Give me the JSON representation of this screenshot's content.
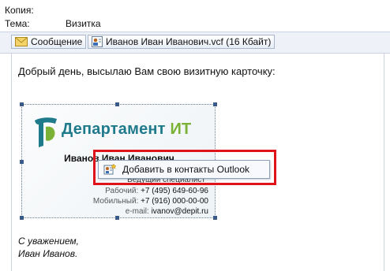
{
  "header": {
    "copy_label": "Копия:",
    "copy_value": "",
    "subject_label": "Тема:",
    "subject_value": "Визитка"
  },
  "attachments": {
    "message_tab": "Сообщение",
    "vcf_file": "Иванов Иван Иванович.vcf (16 Кбайт)"
  },
  "body": {
    "greeting": "Добрый день, высылаю Вам свою визитную карточку:",
    "signature_line1": "С уважением,",
    "signature_line2": "Иван Иванов."
  },
  "card": {
    "logo_word": "Департамент",
    "logo_accent": "ИТ",
    "name": "Иванов Иван Иванович",
    "role": "Ведущий специалист",
    "work_label": "Рабочий:",
    "work_value": "+7 (495) 649-60-96",
    "mobile_label": "Мобильный:",
    "mobile_value": "+7 (916) 000-00-00",
    "email_label": "e-mail:",
    "email_value": "ivanov@depit.ru"
  },
  "context_menu": {
    "add_contact": "Добавить в контакты Outlook"
  },
  "colors": {
    "highlight": "#e0121a",
    "logo_teal": "#1f7a8c",
    "logo_green": "#7bb236"
  }
}
